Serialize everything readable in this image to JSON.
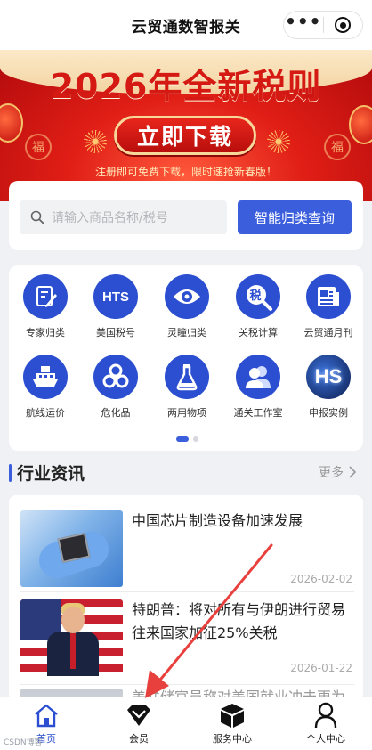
{
  "window": {
    "title": "云贸通数智报关"
  },
  "banner": {
    "title": "2026年全新税则",
    "button": "立即下载",
    "subtitle": "注册即可免费下载，限时速抢新春版！",
    "fu_char": "福"
  },
  "search": {
    "placeholder": "请输入商品名称/税号",
    "button": "智能归类查询"
  },
  "grid": {
    "items": [
      {
        "label": "专家归类",
        "icon": "pen-document-icon"
      },
      {
        "label": "美国税号",
        "icon": "hts-icon",
        "text": "HTS"
      },
      {
        "label": "灵瞳归类",
        "icon": "eye-icon"
      },
      {
        "label": "关税计算",
        "icon": "tax-magnifier-icon",
        "text": "税"
      },
      {
        "label": "云贸通月刊",
        "icon": "magazine-icon"
      },
      {
        "label": "航线运价",
        "icon": "ship-icon"
      },
      {
        "label": "危化品",
        "icon": "biohazard-icon"
      },
      {
        "label": "两用物项",
        "icon": "flask-icon"
      },
      {
        "label": "通关工作室",
        "icon": "users-icon"
      },
      {
        "label": "申报实例",
        "icon": "hs-icon",
        "text": "HS"
      }
    ],
    "page": 1,
    "pages": 2
  },
  "news": {
    "title": "行业资讯",
    "more": "更多",
    "items": [
      {
        "title": "中国芯片制造设备加速发展",
        "date": "2026-02-02",
        "image": "chip-photo"
      },
      {
        "title": "特朗普：将对所有与伊朗进行贸易往来国家加征25%关税",
        "date": "2026-01-22",
        "image": "flag-photo"
      },
      {
        "title": "美联储官员称对美国就业冲击更为明显",
        "date": "",
        "image": "faded-photo"
      }
    ]
  },
  "tabbar": {
    "tabs": [
      {
        "label": "首页",
        "icon": "home-icon",
        "active": true
      },
      {
        "label": "会员",
        "icon": "vip-diamond-icon",
        "active": false
      },
      {
        "label": "服务中心",
        "icon": "box-icon",
        "active": false
      },
      {
        "label": "个人中心",
        "icon": "person-icon",
        "active": false
      }
    ]
  },
  "watermark": "CSDN博客",
  "colors": {
    "primary": "#2b4fd0",
    "accent_button": "#3b5fdc",
    "banner_red": "#d41a12",
    "annotation_arrow": "#e8403c"
  }
}
